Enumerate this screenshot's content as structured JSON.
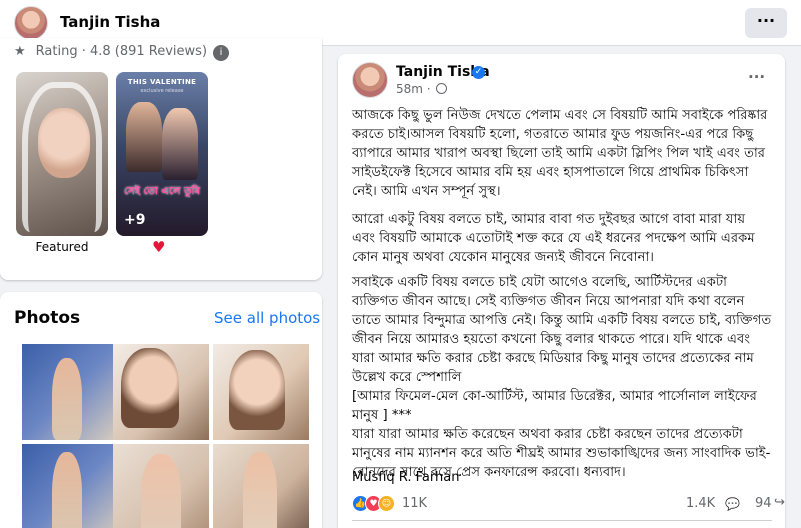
{
  "topbar": {
    "page_name": "Tanjin Tisha",
    "more_label": "···"
  },
  "featured": {
    "rating_text": "Rating · 4.8 (891 Reviews)",
    "rating_icon": "star-icon",
    "info_icon": "info-icon",
    "item1_label": "Featured",
    "item2_header": "THIS VALENTINE",
    "item2_sub": "exclusive release",
    "item2_title": "সেই তো এলে তুমি",
    "item2_more": "+9",
    "heart_icon": "heart-icon"
  },
  "photos": {
    "title": "Photos",
    "see_all": "See all photos"
  },
  "post": {
    "author": "Tanjin Tisha",
    "time": "58m",
    "verified_icon": "verified-badge-icon",
    "privacy_icon": "globe-icon",
    "more_label": "···",
    "paragraphs": [
      "আজকে কিছু ভুল নিউজ দেখতে পেলাম এবং সে বিষয়টি আমি সবাইকে পরিষ্কার করতে চাই।আসল বিষয়টি হলো, গতরাতে আমার ফুড পয়জনিং-এর পরে কিছু ব্যাপারে আমার খারাপ অবস্থা ছিলো তাই আমি একটা স্লিপিং পিল খাই এবং তার সাইডইফেক্ট হিসেবে আমার বমি হয় এবং হাসপাতালে গিয়ে প্রাথমিক চিকিৎসা নেই। আমি এখন সম্পূর্ন সুস্থ।",
      " আরো একটু বিষয় বলতে চাই, আমার বাবা গত দুইবছর আগে বাবা মারা যায় এবং বিষয়টি আমাকে এতোটাই শক্ত করে যে এই ধরনের পদক্ষেপ আমি এরকম কোন মানুষ অথবা যেকোন মানুষের জন্যই জীবনে নিবোনা।",
      "সবাইকে একটি বিষয় বলতে চাই যেটা আগেও বলেছি, আর্টিস্টদের একটা ব্যক্তিগত জীবন আছে। সেই ব্যক্তিগত জীবন নিয়ে আপনারা যদি কথা বলেন তাতে আমার বিন্দুমাত্র আপত্তি নেই। কিন্তু আমি একটি বিষয় বলতে চাই, ব্যক্তিগত জীবন নিয়ে আমারও হয়তো কখনো কিছু বলার থাকতে পারে। যদি থাকে এবং যারা আমার ক্ষতি করার চেষ্টা করছে মিডিয়ার কিছু মানুষ তাদের প্রত্যেকের নাম উল্লেখ করে স্পেশালি\n [আমার ফিমেল-মেল কো-আর্টিস্ট, আমার ডিরেক্টর, আমার পার্সোনাল লাইফের মানুষ ] ***\nযারা যারা আমার ক্ষতি করেছেন অথবা করার চেষ্টা করছেন তাদের প্রত্যেকটা মানুষের নাম ম্যানশন করে অতি শীঘ্রই আমার শুভাকাঙ্খিদের জন্য সাংবাদিক ভাই-বোনদের সাথে বসে প্রেস কনফারেন্স করবো। ধন্যবাদ।"
    ],
    "signature": "Musfiq R. Farhan",
    "reaction_count": "11K",
    "comment_count": "1.4K",
    "share_count": "94",
    "reaction_icons": [
      "like-icon",
      "love-icon",
      "haha-icon"
    ]
  },
  "colors": {
    "accent": "#1877f2",
    "background": "#f0f2f5",
    "secondary_text": "#65676b"
  }
}
